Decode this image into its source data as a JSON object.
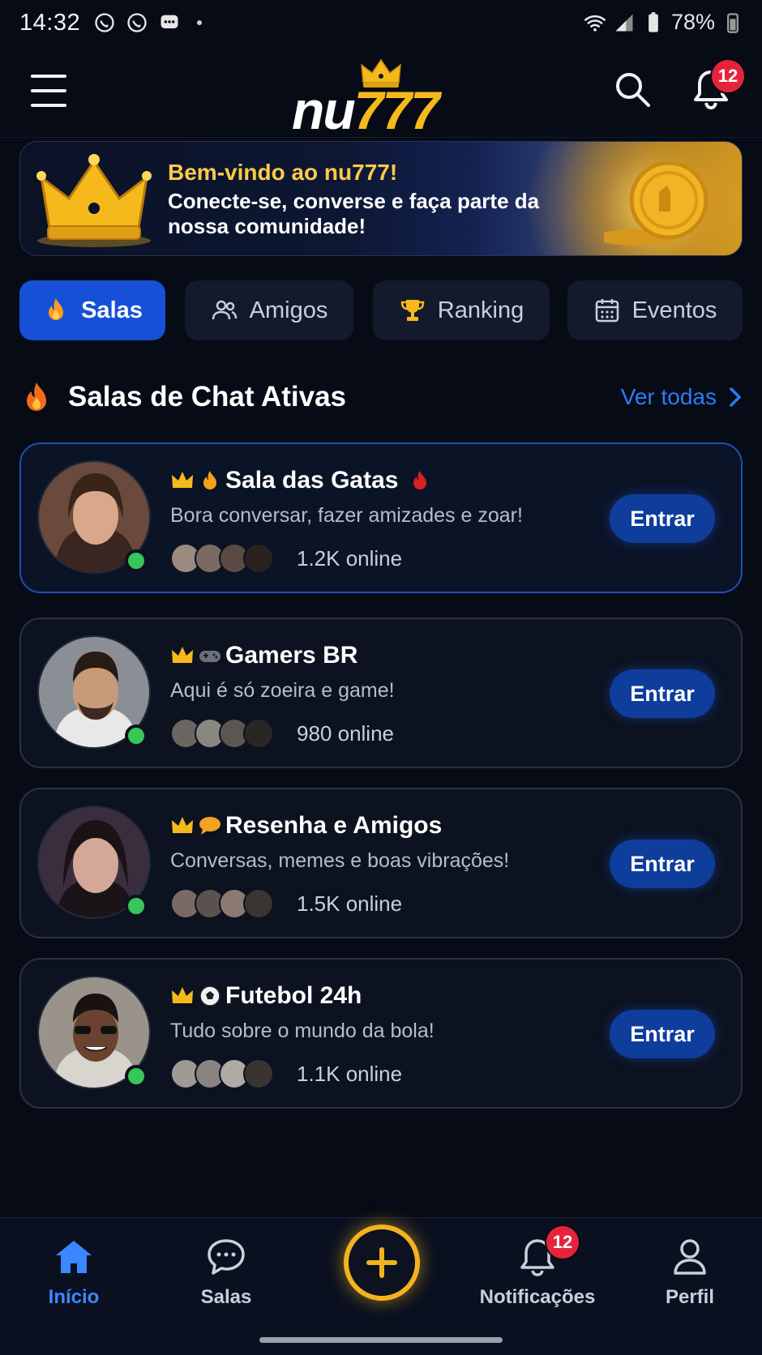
{
  "status_bar": {
    "time": "14:32",
    "battery": "78%"
  },
  "header": {
    "logo_prefix": "nu",
    "logo_suffix": "777",
    "notification_count": "12"
  },
  "banner": {
    "title": "Bem-vindo ao nu777!",
    "subtitle": "Conecte-se, converse e faça parte da nossa comunidade!"
  },
  "tabs": [
    {
      "label": "Salas",
      "icon": "fire-icon",
      "active": true
    },
    {
      "label": "Amigos",
      "icon": "users-icon",
      "active": false
    },
    {
      "label": "Ranking",
      "icon": "trophy-icon",
      "active": false
    },
    {
      "label": "Eventos",
      "icon": "calendar-icon",
      "active": false
    }
  ],
  "section": {
    "title": "Salas de Chat Ativas",
    "see_all": "Ver todas"
  },
  "rooms": [
    {
      "name": "Sala das Gatas",
      "emoji": [
        "crown-icon",
        "flame-icon"
      ],
      "trail": "flame-icon",
      "description": "Bora conversar, fazer amizades e zoar!",
      "online": "1.2K online",
      "button": "Entrar"
    },
    {
      "name": "Gamers BR",
      "emoji": [
        "crown-icon",
        "gamepad-icon"
      ],
      "description": "Aqui é só zoeira e game!",
      "online": "980 online",
      "button": "Entrar"
    },
    {
      "name": "Resenha e Amigos",
      "emoji": [
        "crown-icon",
        "speech-bubble-icon"
      ],
      "description": "Conversas, memes e boas vibrações!",
      "online": "1.5K online",
      "button": "Entrar"
    },
    {
      "name": "Futebol 24h",
      "emoji": [
        "crown-icon",
        "soccer-ball-icon"
      ],
      "description": "Tudo sobre o mundo da bola!",
      "online": "1.1K online",
      "button": "Entrar"
    }
  ],
  "bottom_nav": {
    "items": [
      {
        "label": "Início",
        "icon": "home-icon",
        "active": true
      },
      {
        "label": "Salas",
        "icon": "chat-icon",
        "active": false
      },
      {
        "label": "Notificações",
        "icon": "bell-icon",
        "active": false
      },
      {
        "label": "Perfil",
        "icon": "user-icon",
        "active": false
      }
    ],
    "notification_count": "12"
  },
  "colors": {
    "background": "#070b16",
    "accent": "#1550d6",
    "gold": "#f5b91c",
    "online": "#38c659",
    "badge": "#e5243b"
  }
}
